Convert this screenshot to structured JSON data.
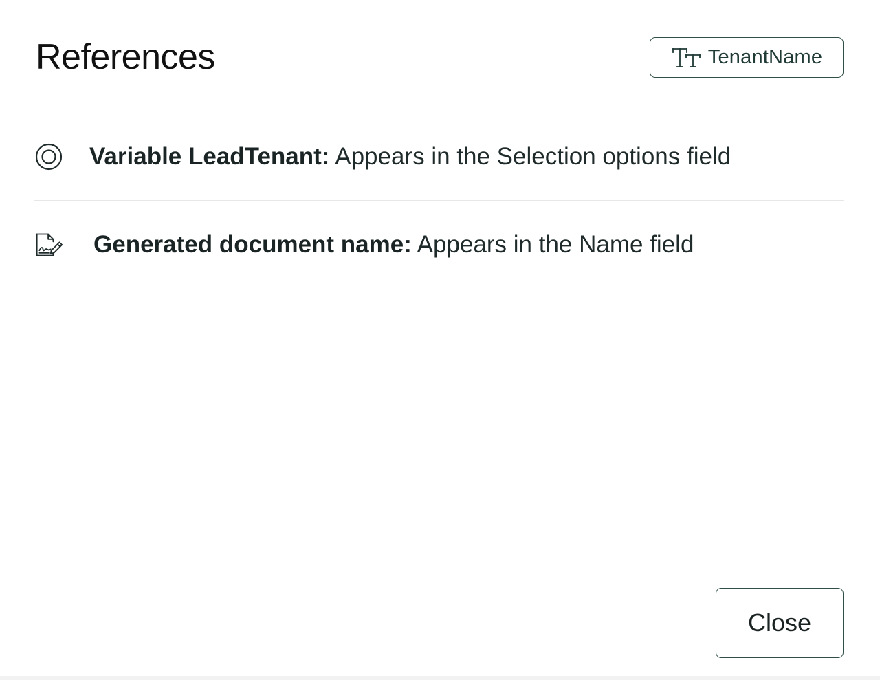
{
  "dialog": {
    "title": "References",
    "tag_chip": {
      "icon": "text-size-icon",
      "label": "TenantName"
    },
    "references": [
      {
        "icon": "radio-target-icon",
        "name": "Variable LeadTenant:",
        "description": " Appears in the Selection options field"
      },
      {
        "icon": "document-signature-icon",
        "name": "Generated document name:",
        "description": " Appears in the Name field"
      }
    ],
    "close_label": "Close"
  },
  "colors": {
    "accent_border": "#2f4f48",
    "text": "#1f2a2a",
    "divider": "#e6e8e8"
  }
}
